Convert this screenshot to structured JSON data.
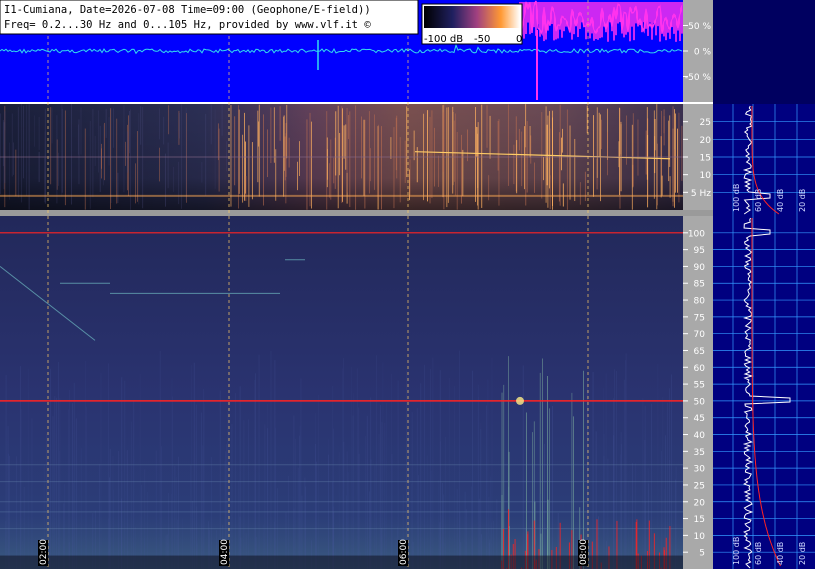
{
  "header": {
    "line1": "I1-Cumiana, Date=2026-07-08 Time=09:00 (Geophone/E-field))",
    "line2": "Freq= 0.2...30 Hz and 0...105 Hz, provided by www.vlf.it ©"
  },
  "colorbar": {
    "labels": [
      "-100 dB",
      "-50",
      "0"
    ],
    "values": [
      -100,
      -50,
      0
    ],
    "unit": "dB"
  },
  "colors": {
    "waveform_bg": "#0000ff",
    "trace_cyan": "#33ddee",
    "trace_magenta": "#ff33ee",
    "axis_gray": "#a9a9a9",
    "side_bg": "#000080",
    "grid_blue": "#3399ff",
    "marker_red": "#ff2222"
  },
  "chart_data": [
    {
      "type": "line",
      "panel": "waveform",
      "series": [
        {
          "color": "#33ddee",
          "values": [
            0,
            0.1,
            -0.05,
            0.2,
            -0.1,
            0.05,
            0.9,
            -0.3,
            0.1,
            0,
            -0.05,
            0.1,
            0,
            0.05,
            -0.1,
            0.05,
            0,
            0.1,
            -0.05,
            0,
            0.1,
            -0.2,
            0.4,
            -0.3,
            0.1,
            0,
            0.05,
            -0.05,
            0.1,
            0
          ]
        },
        {
          "color": "#ff33ee",
          "values": [
            0,
            0,
            0,
            0,
            0,
            0,
            0,
            0,
            0,
            0,
            0,
            0,
            0,
            0,
            0,
            0,
            0,
            0,
            0,
            0,
            0,
            0,
            0.4,
            1.0,
            0.85,
            0.95,
            0.8,
            0.9,
            0.85,
            0.9
          ]
        }
      ],
      "ylim": [
        -100,
        100
      ],
      "ytick_labels": [
        "50 %",
        "0 %",
        "-50 %"
      ],
      "ytick_values": [
        50,
        0,
        -50
      ]
    },
    {
      "type": "heatmap",
      "panel": "spectrogram-low",
      "ylim": [
        0,
        30
      ],
      "ytick_labels": [
        "25",
        "20",
        "15",
        "10",
        "5 Hz"
      ],
      "ytick_values": [
        25,
        20,
        15,
        10,
        5
      ],
      "side_labels": [
        "100 dB",
        "60 dB",
        "40 dB",
        "20 dB"
      ]
    },
    {
      "type": "heatmap",
      "panel": "spectrogram-high",
      "ylim": [
        0,
        105
      ],
      "ytick_labels": [
        "100",
        "95",
        "90",
        "85",
        "80",
        "75",
        "70",
        "65",
        "60",
        "55",
        "50",
        "45",
        "40",
        "35",
        "30",
        "25",
        "20",
        "15",
        "10",
        "5"
      ],
      "ytick_values": [
        100,
        95,
        90,
        85,
        80,
        75,
        70,
        65,
        60,
        55,
        50,
        45,
        40,
        35,
        30,
        25,
        20,
        15,
        10,
        5
      ],
      "xtick_labels": [
        "02:00",
        "04:00",
        "06:00",
        "08:00"
      ],
      "side_labels": [
        "100 dB",
        "60 dB",
        "40 dB",
        "20 dB"
      ]
    }
  ]
}
